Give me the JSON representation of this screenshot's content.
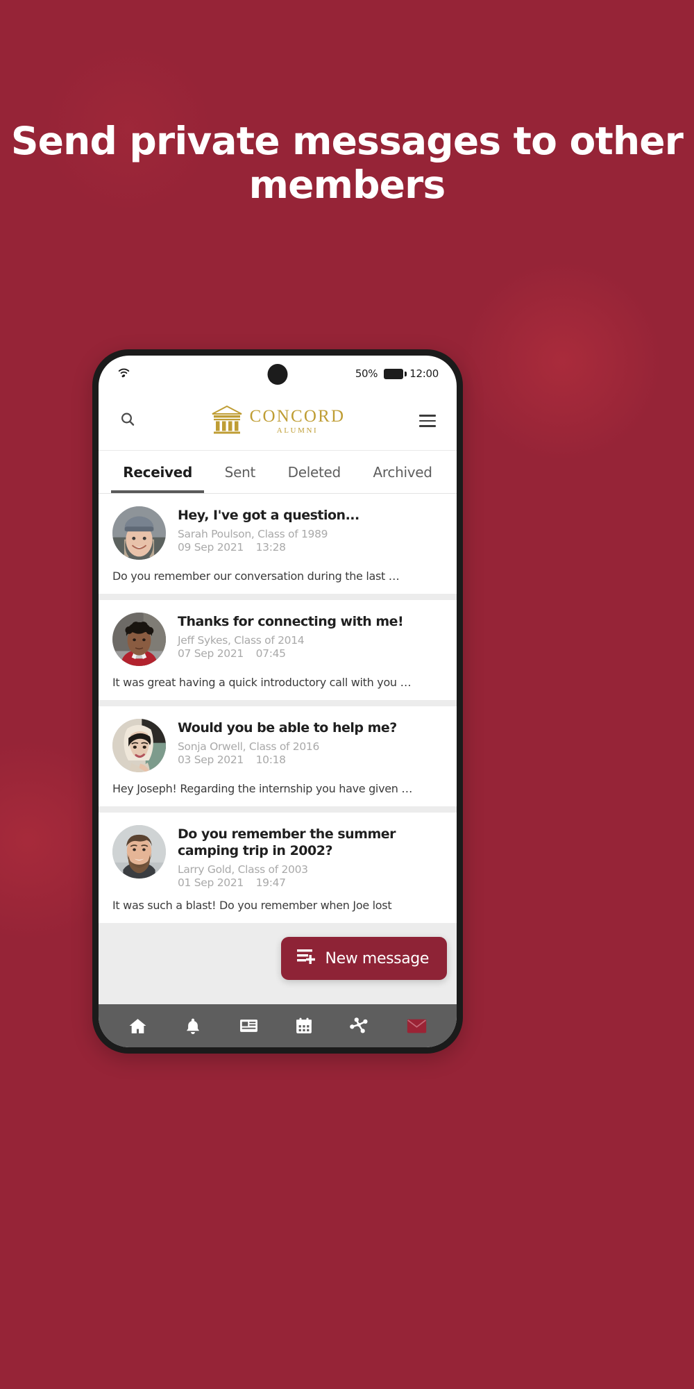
{
  "page": {
    "background_color": "#962437",
    "headline": "Send private messages to other members"
  },
  "phone": {
    "status_bar": {
      "wifi_icon": "wifi-icon",
      "battery_percent": "50%",
      "battery_icon": "battery-icon",
      "clock": "12:00"
    },
    "app_header": {
      "search_icon": "search-icon",
      "logo": {
        "icon": "temple-columns-icon",
        "name": "CONCORD",
        "subtitle": "ALUMNI",
        "color": "#bf9d34"
      },
      "menu_icon": "hamburger-menu-icon"
    },
    "tabs": [
      {
        "label": "Received",
        "active": true
      },
      {
        "label": "Sent",
        "active": false
      },
      {
        "label": "Deleted",
        "active": false
      },
      {
        "label": "Archived",
        "active": false
      }
    ],
    "messages": [
      {
        "subject": "Hey, I've got a question...",
        "sender": "Sarah Poulson, Class of 1989",
        "date": "09 Sep 2021",
        "time": "13:28",
        "preview": "Do you remember our conversation during the last …",
        "avatar": "woman-grey-beanie-avatar"
      },
      {
        "subject": "Thanks for connecting with me!",
        "sender": "Jeff Sykes, Class of 2014",
        "date": "07 Sep 2021",
        "time": "07:45",
        "preview": "It was great having a quick introductory call with you …",
        "avatar": "young-man-varsity-jacket-avatar"
      },
      {
        "subject": "Would you be able to help me?",
        "sender": "Sonja Orwell, Class of 2016",
        "date": "03 Sep 2021",
        "time": "10:18",
        "preview": "Hey Joseph! Regarding the internship you have given …",
        "avatar": "woman-hijab-avatar"
      },
      {
        "subject": "Do you remember the summer camping trip in 2002?",
        "sender": "Larry Gold, Class of 2003",
        "date": "01 Sep 2021",
        "time": "19:47",
        "preview": "It was such a blast! Do you remember when Joe lost",
        "avatar": "bearded-man-avatar"
      }
    ],
    "new_message_button": {
      "label": "New message",
      "icon": "compose-lines-plus-icon",
      "color": "#8e2336"
    },
    "bottom_nav": [
      {
        "icon": "home-icon",
        "active": false
      },
      {
        "icon": "bell-icon",
        "active": false
      },
      {
        "icon": "news-icon",
        "active": false
      },
      {
        "icon": "calendar-icon",
        "active": false
      },
      {
        "icon": "network-share-icon",
        "active": false
      },
      {
        "icon": "envelope-icon",
        "active": true,
        "color": "#9b2335"
      }
    ]
  }
}
